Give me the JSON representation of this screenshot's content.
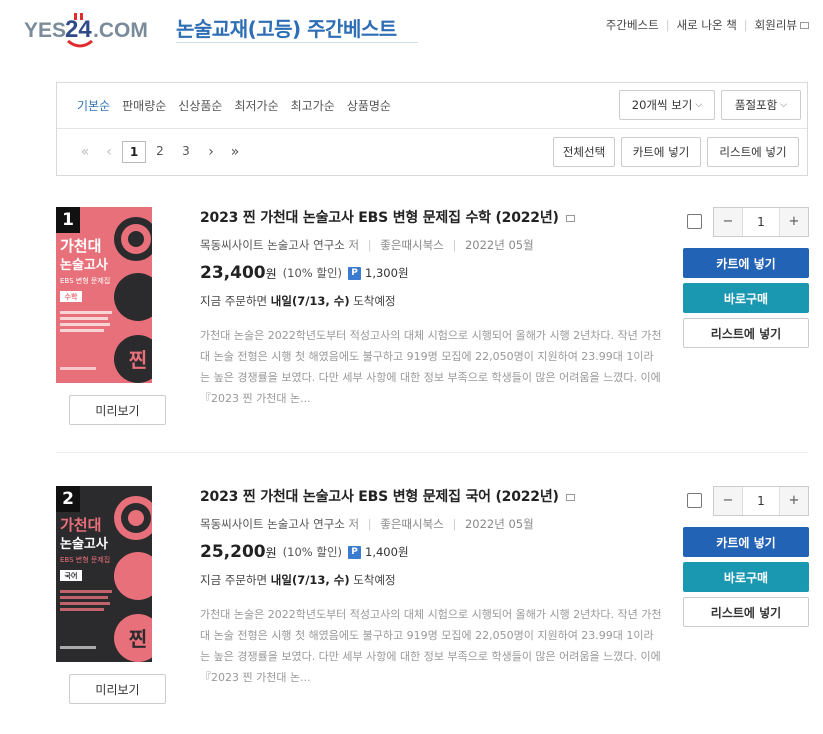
{
  "header": {
    "logo_text": "YES24.COM",
    "page_title": "논술교재(고등) 주간베스트",
    "links": [
      "주간베스트",
      "새로 나온 책",
      "회원리뷰"
    ]
  },
  "filter": {
    "sort_options": [
      "기본순",
      "판매량순",
      "신상품순",
      "최저가순",
      "최고가순",
      "상품명순"
    ],
    "active_sort": "기본순",
    "view_count": "20개씩 보기",
    "stock_filter": "품절포함",
    "pages": [
      "1",
      "2",
      "3"
    ],
    "current_page": "1",
    "select_all": "전체선택",
    "add_to_cart": "카트에 넣기",
    "add_to_list": "리스트에 넣기"
  },
  "items": [
    {
      "rank": "1",
      "title": "2023 찐 가천대 논술고사 EBS 변형 문제집 수학 (2022년)",
      "author": "목동씨사이트 논술고사 연구소",
      "author_role": "저",
      "publisher": "좋은때시북스",
      "pub_date": "2022년 05월",
      "price": "23,400",
      "price_unit": "원",
      "discount": "(10% 할인)",
      "point_badge": "P",
      "point": "1,300원",
      "ship_prefix": "지금 주문하면",
      "ship_date": "내일(7/13, 수)",
      "ship_suffix": "도착예정",
      "desc": "가천대 논술은 2022학년도부터 적성고사의 대체 시험으로 시행되어 올해가 시행 2년차다. 작년 가천대 논술 전형은 시행 첫 해였음에도 불구하고 919명 모집에 22,050명이 지원하여 23.99대 1이라는 높은 경쟁률을 보였다. 다만 세부 사항에 대한 정보 부족으로 학생들이 많은 어려움을 느꼈다. 이에 『2023 찐 가천대 논...",
      "qty": "1",
      "cover_title": "가천대 논술고사",
      "cover_sub": "EBS 변형 문제집",
      "cover_subject": "수학",
      "cover_color": "#e8707a",
      "preview": "미리보기",
      "btn_cart": "카트에 넣기",
      "btn_buy": "바로구매",
      "btn_list": "리스트에 넣기"
    },
    {
      "rank": "2",
      "title": "2023 찐 가천대 논술고사 EBS 변형 문제집 국어 (2022년)",
      "author": "목동씨사이트 논술고사 연구소",
      "author_role": "저",
      "publisher": "좋은때시북스",
      "pub_date": "2022년 05월",
      "price": "25,200",
      "price_unit": "원",
      "discount": "(10% 할인)",
      "point_badge": "P",
      "point": "1,400원",
      "ship_prefix": "지금 주문하면",
      "ship_date": "내일(7/13, 수)",
      "ship_suffix": "도착예정",
      "desc": "가천대 논술은 2022학년도부터 적성고사의 대체 시험으로 시행되어 올해가 시행 2년차다. 작년 가천대 논술 전형은 시행 첫 해였음에도 불구하고 919명 모집에 22,050명이 지원하여 23.99대 1이라는 높은 경쟁률을 보였다. 다만 세부 사항에 대한 정보 부족으로 학생들이 많은 어려움을 느꼈다. 이에 『2023 찐 가천대 논...",
      "qty": "1",
      "cover_title": "가천대 논술고사",
      "cover_sub": "EBS 변형 문제집",
      "cover_subject": "국어",
      "cover_color": "#2b2b2e",
      "preview": "미리보기",
      "btn_cart": "카트에 넣기",
      "btn_buy": "바로구매",
      "btn_list": "리스트에 넣기"
    }
  ]
}
